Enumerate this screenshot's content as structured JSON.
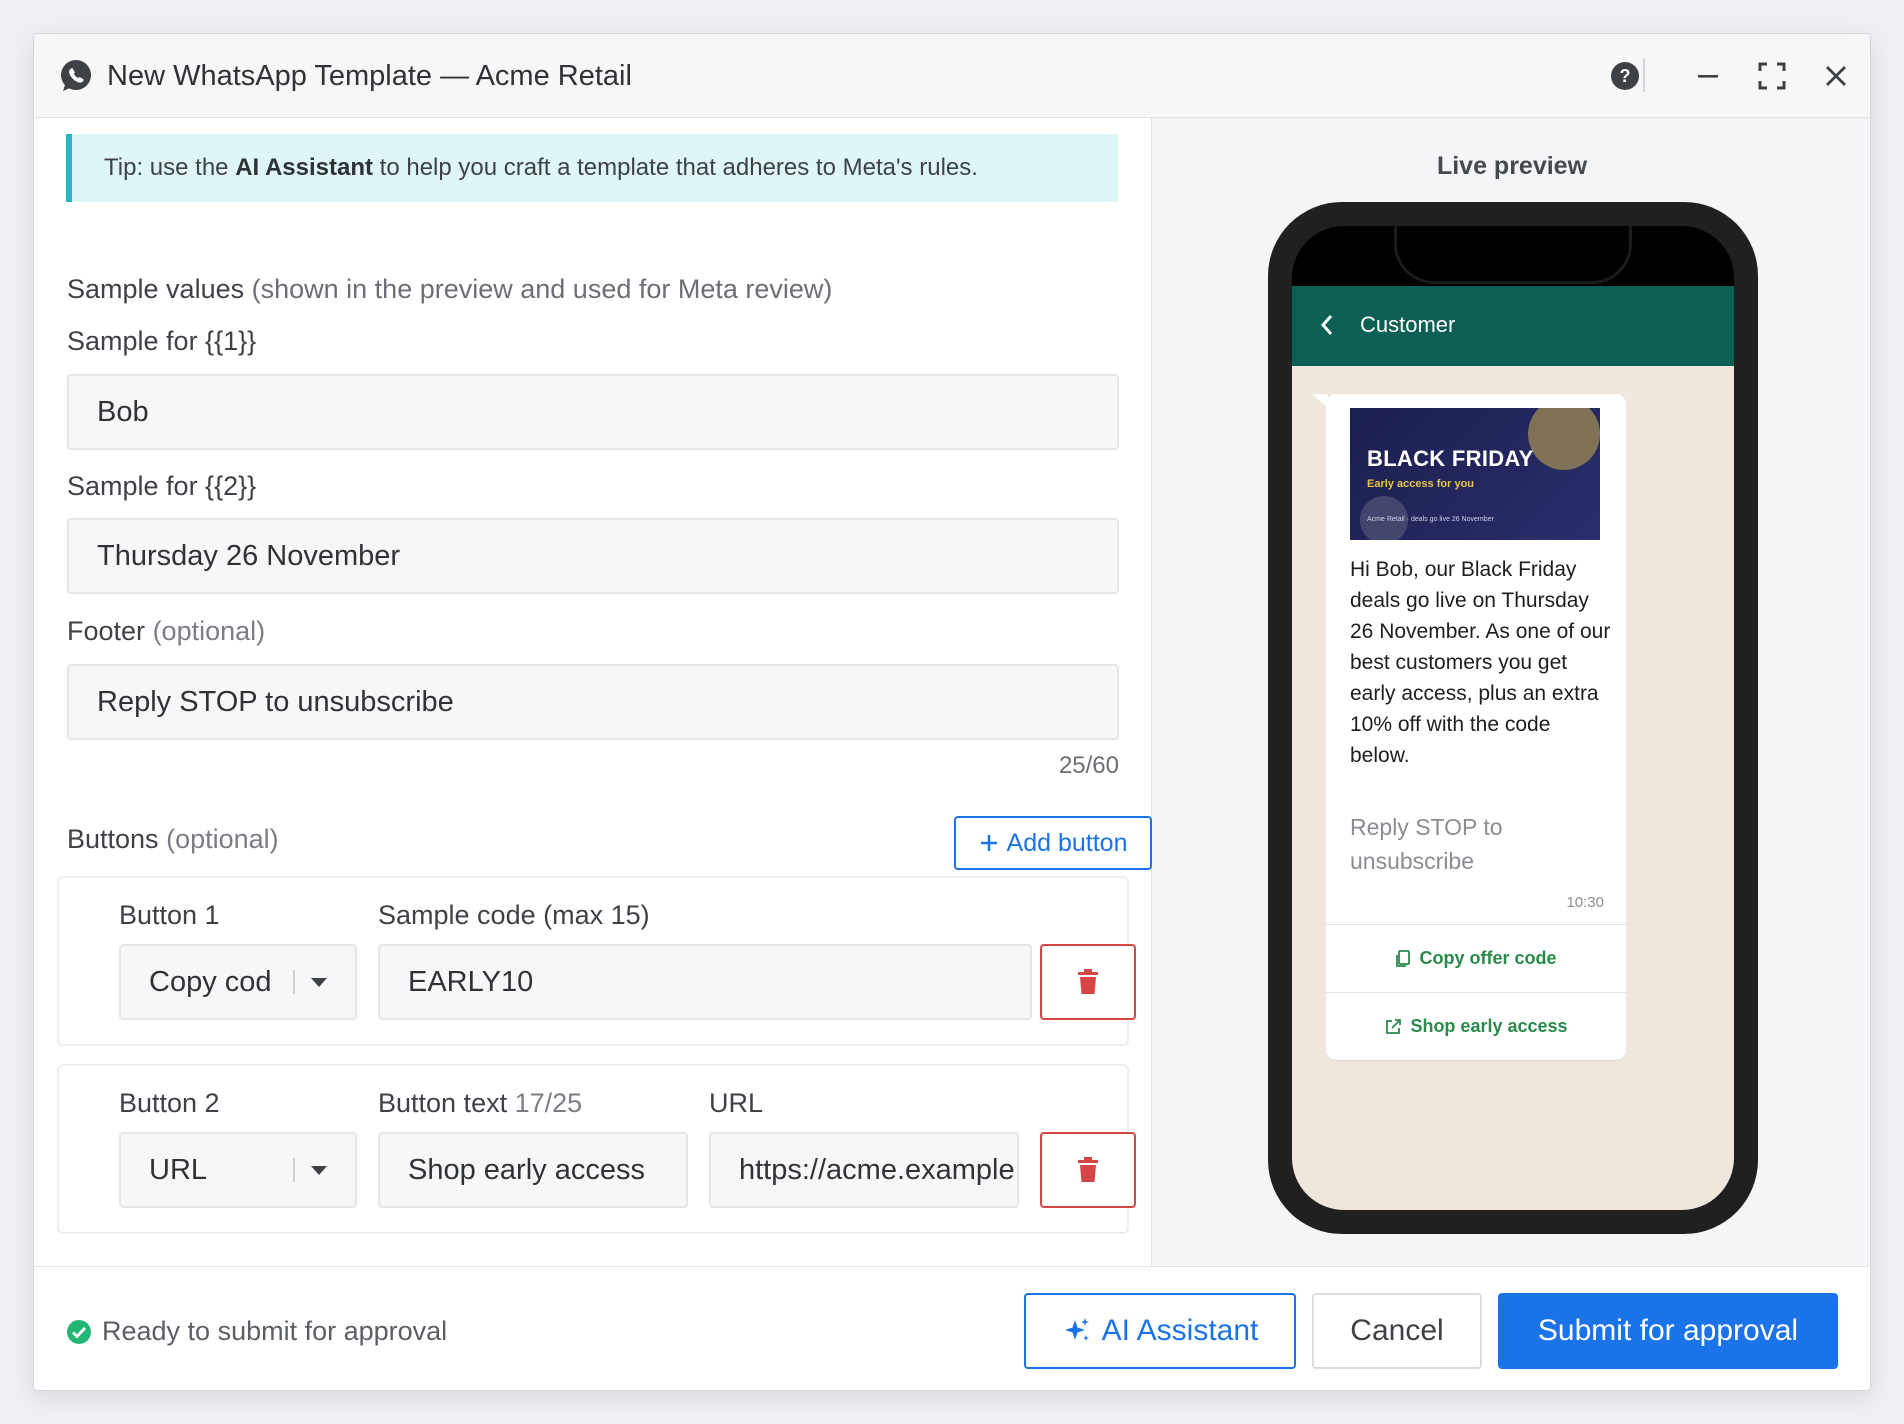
{
  "header": {
    "title": "New WhatsApp Template — Acme Retail"
  },
  "tip": {
    "prefix": "Tip: use the ",
    "highlight": "AI Assistant",
    "suffix": " to help you craft a template that adheres to Meta's rules."
  },
  "samples": {
    "heading": "Sample values",
    "heading_note": "(shown in the preview and used for Meta review)",
    "sample1_label": "Sample for {{1}}",
    "sample1_value": "Bob",
    "sample2_label": "Sample for {{2}}",
    "sample2_value": "Thursday 26 November"
  },
  "footer_field": {
    "label": "Footer",
    "label_note": "(optional)",
    "value": "Reply STOP to unsubscribe",
    "counter": "25/60"
  },
  "buttons_section": {
    "label": "Buttons",
    "label_note": "(optional)",
    "add_button": "Add button",
    "button1": {
      "label": "Button 1",
      "type": "Copy code",
      "code_label": "Sample code (max 15)",
      "code_value": "EARLY10"
    },
    "button2": {
      "label": "Button 2",
      "type": "URL",
      "text_label": "Button text",
      "text_counter": "17/25",
      "text_value": "Shop early access",
      "url_label": "URL",
      "url_value": "https://acme.example.com/black-friday"
    }
  },
  "bottom_bar": {
    "status": "Ready to submit for approval",
    "ai_button": "AI Assistant",
    "cancel_button": "Cancel",
    "submit_button": "Submit for approval"
  },
  "preview": {
    "label": "Live preview",
    "contact_name": "Customer",
    "banner_title": "BLACK FRIDAY",
    "banner_subtitle": "Early access for you",
    "banner_footer": "Acme Retail · deals go live 26 November",
    "message_body": "Hi Bob, our Black Friday deals go live on Thursday 26 November. As one of our best customers you get early access, plus an extra 10% off with the code below.",
    "message_footer": "Reply STOP to unsubscribe",
    "time": "10:30",
    "quick_button1": "Copy offer code",
    "quick_button2": "Shop early access"
  },
  "colors": {
    "accent": "#1a73e8",
    "whatsapp_bar": "#0b5f53",
    "danger": "#d64545",
    "success": "#22b573",
    "tip_bg": "#dff6f7"
  }
}
